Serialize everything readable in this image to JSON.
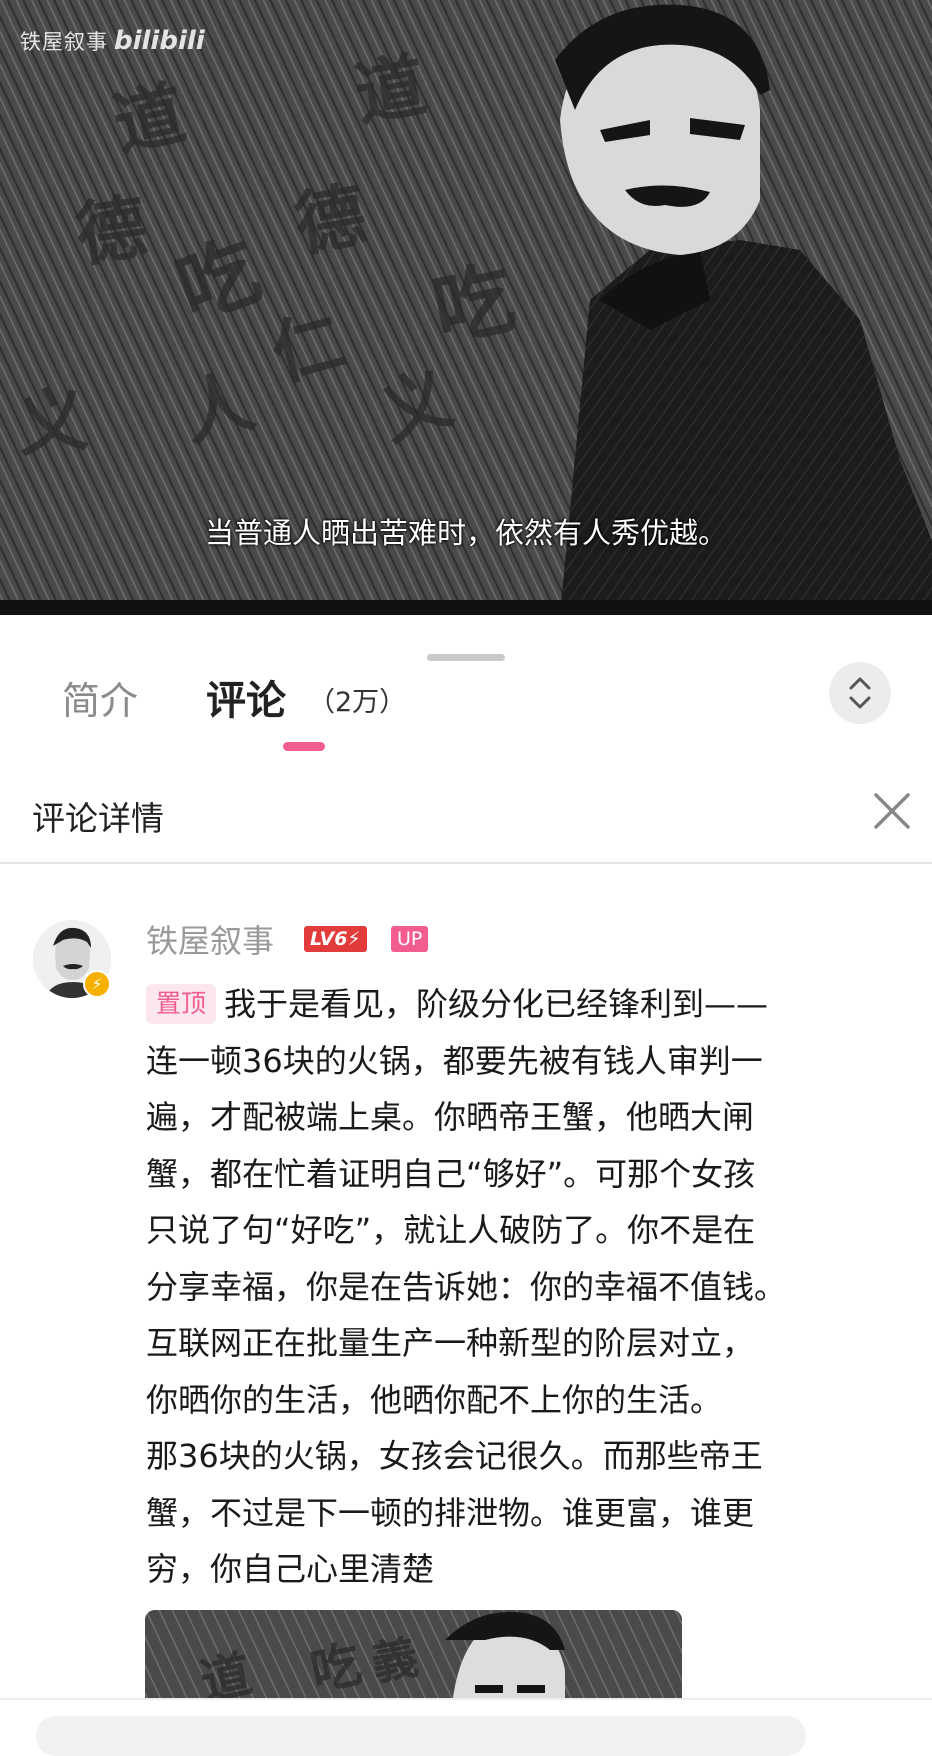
{
  "video": {
    "watermark_channel": "铁屋叙事",
    "watermark_logo": "bilibili",
    "subtitle": "当普通人晒出苦难时，依然有人秀优越。"
  },
  "tabs": {
    "intro_label": "简介",
    "comments_label": "评论",
    "comments_count": "（2万）",
    "accent_color": "#f25d8e"
  },
  "detail": {
    "title": "评论详情",
    "close_icon": "close-icon"
  },
  "comment": {
    "username": "铁屋叙事",
    "level_badge": "LV6⚡",
    "up_badge": "UP",
    "pinned_label": "置顶",
    "lines": [
      "我于是看见，阶级分化已经锋利到——",
      "连一顿36块的火锅，都要先被有钱人审判一",
      "遍，才配被端上桌。你晒帝王蟹，他晒大闸",
      "蟹，都在忙着证明自己“够好”。可那个女孩",
      "只说了句“好吃”，就让人破防了。你不是在",
      "分享幸福，你是在告诉她：你的幸福不值钱。",
      "互联网正在批量生产一种新型的阶层对立，",
      "你晒你的生活，他晒你配不上你的生活。",
      "那36块的火锅，女孩会记很久。而那些帝王",
      "蟹，不过是下一顿的排泄物。谁更富，谁更",
      "穷，你自己心里清楚"
    ]
  }
}
